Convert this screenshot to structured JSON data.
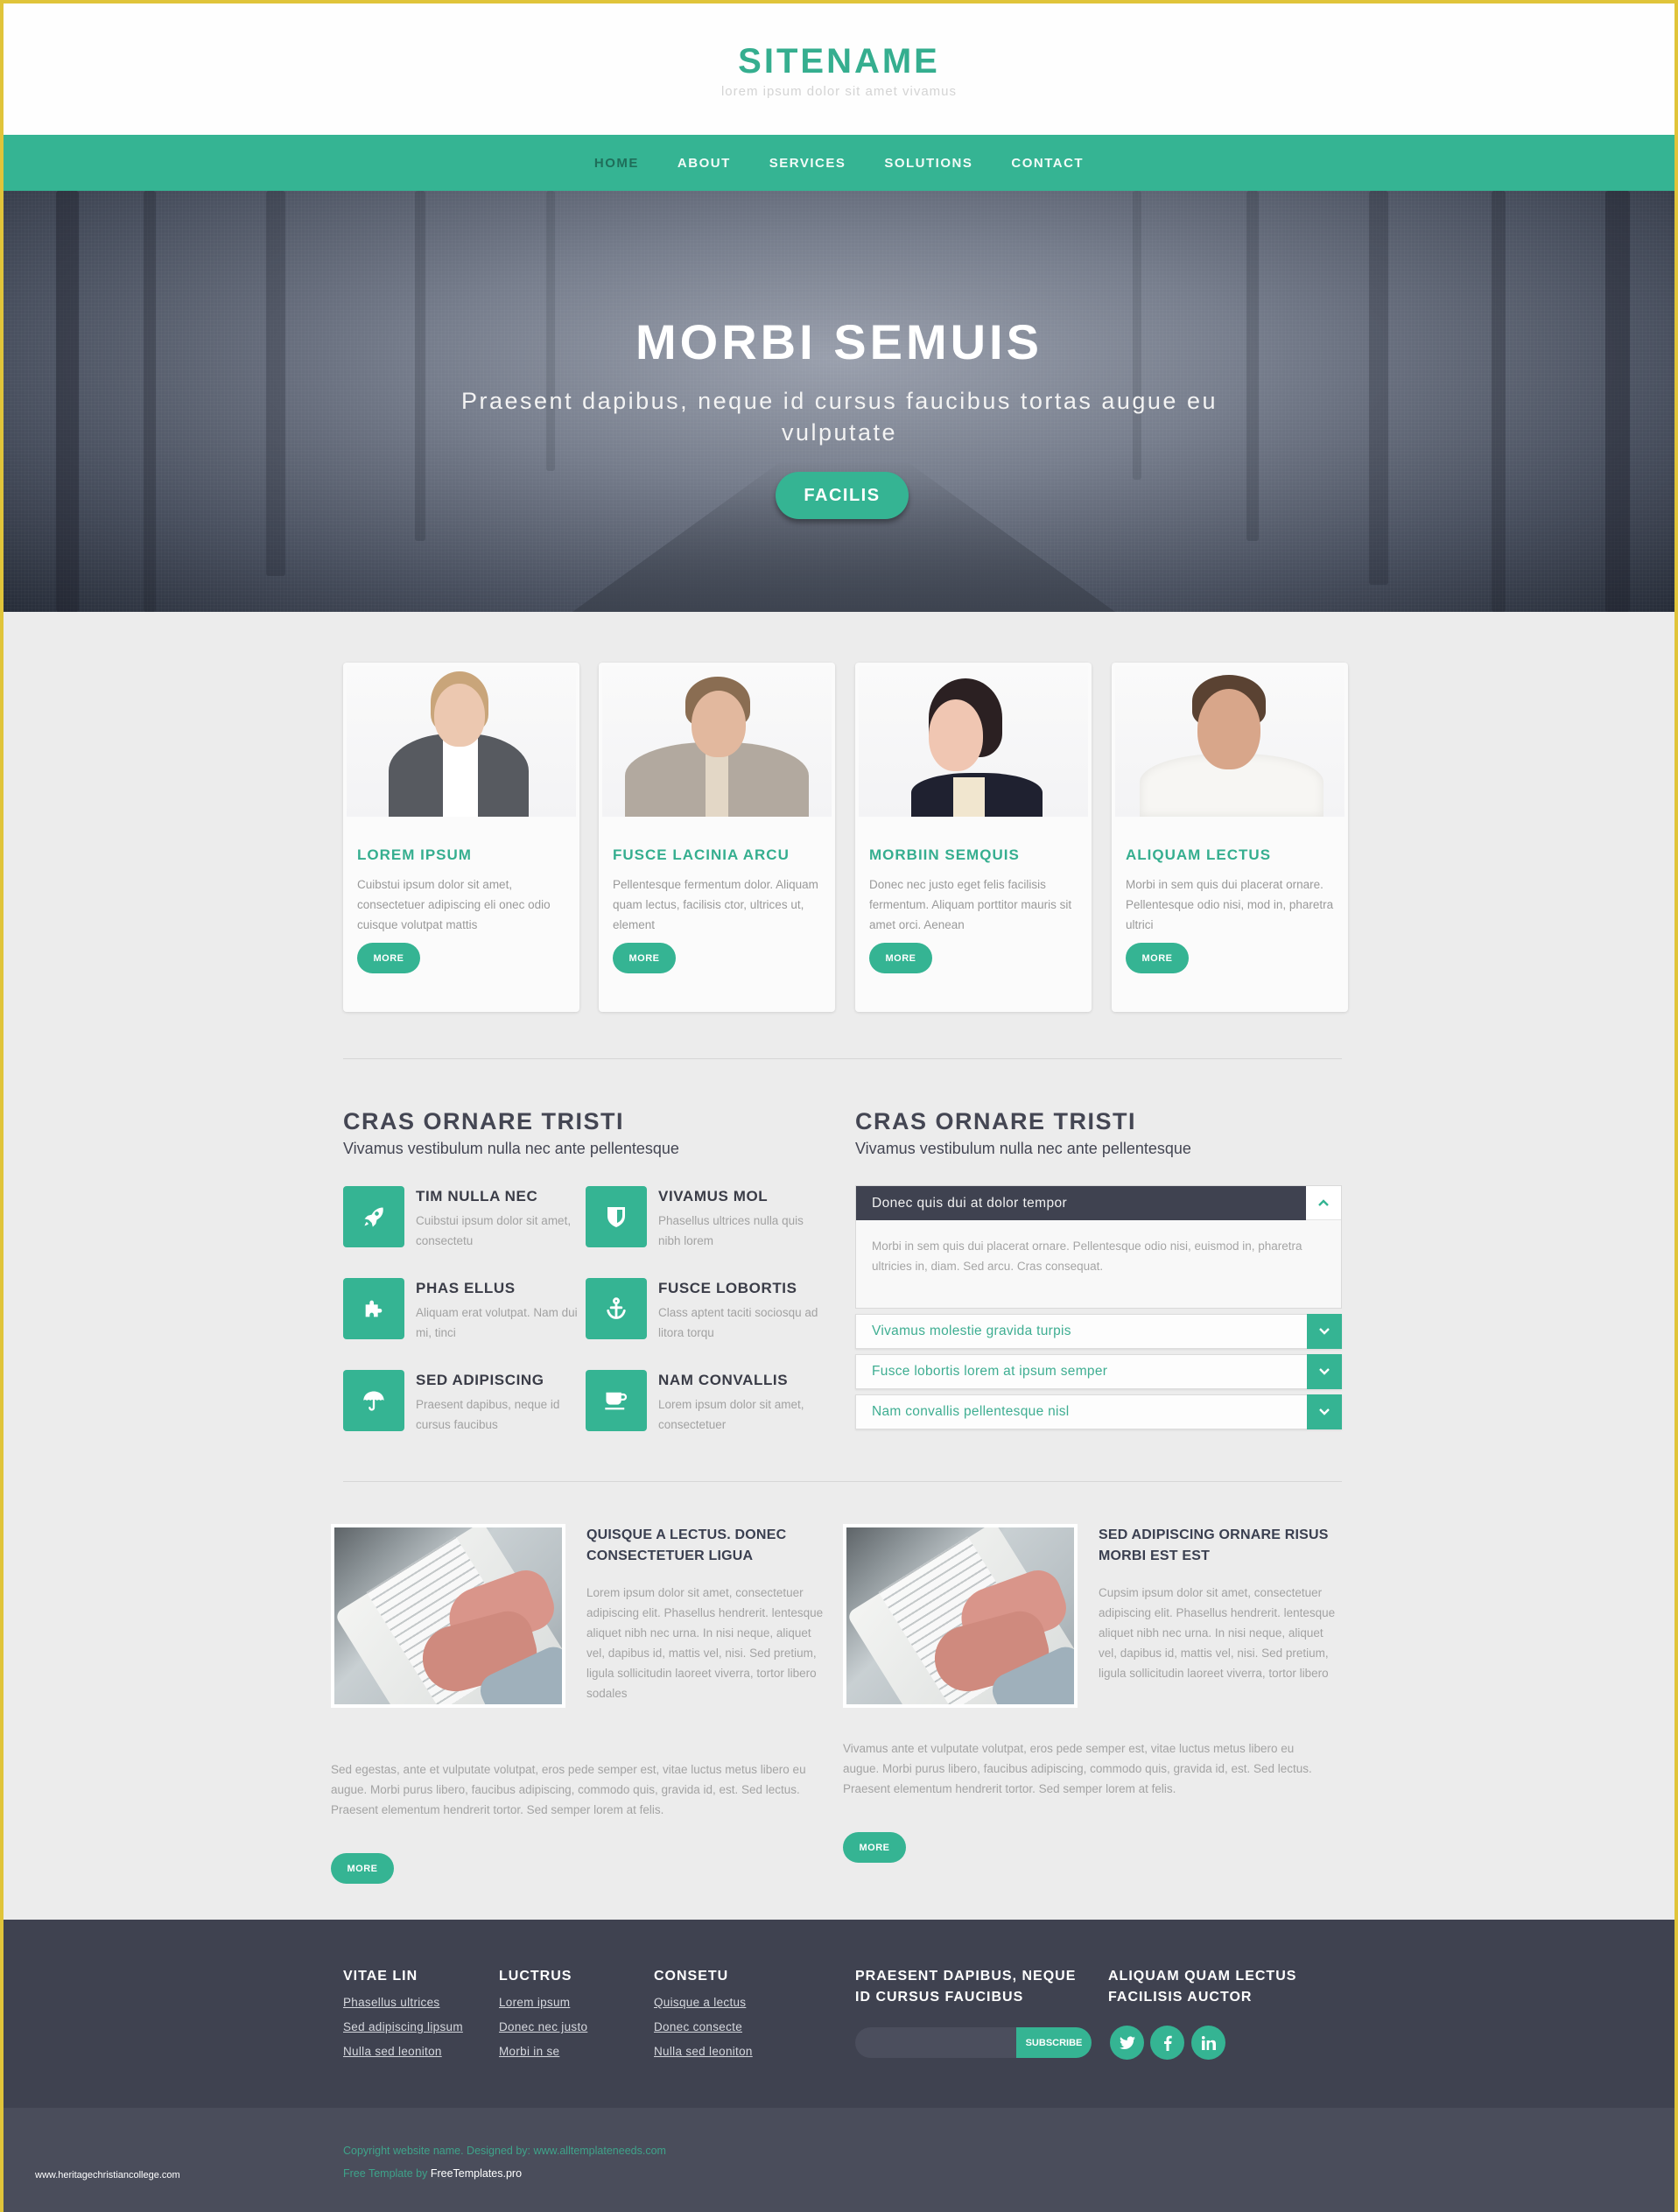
{
  "header": {
    "site_name": "SITENAME",
    "tagline": "lorem ipsum dolor sit amet vivamus"
  },
  "nav": {
    "items": [
      {
        "label": "HOME",
        "active": true
      },
      {
        "label": "ABOUT",
        "active": false
      },
      {
        "label": "SERVICES",
        "active": false
      },
      {
        "label": "SOLUTIONS",
        "active": false
      },
      {
        "label": "CONTACT",
        "active": false
      }
    ]
  },
  "hero": {
    "title": "MORBI SEMUIS",
    "subtitle": "Praesent dapibus, neque id cursus faucibus tortas augue eu vulputate",
    "button_label": "FACILIS"
  },
  "team": [
    {
      "name": "LOREM IPSUM",
      "text": "Cuibstui ipsum dolor sit amet, consectetuer adipiscing eli onec odio cuisque volutpat mattis",
      "button": "MORE"
    },
    {
      "name": "FUSCE LACINIA ARCU",
      "text": "Pellentesque fermentum dolor. Aliquam quam lectus, facilisis ctor, ultrices ut, element",
      "button": "MORE"
    },
    {
      "name": "MORBIIN SEMQUIS",
      "text": "Donec nec justo eget felis facilisis fermentum. Aliquam porttitor mauris sit amet orci. Aenean",
      "button": "MORE"
    },
    {
      "name": "ALIQUAM LECTUS",
      "text": "Morbi in sem quis dui placerat ornare. Pellentesque odio nisi, mod in, pharetra ultrici",
      "button": "MORE"
    }
  ],
  "features": {
    "title": "CRAS ORNARE TRISTI",
    "subtitle": "Vivamus vestibulum nulla nec ante pellentesque",
    "items": [
      {
        "icon": "rocket-icon",
        "title": "TIM NULLA NEC",
        "text": "Cuibstui ipsum dolor sit amet, consectetu"
      },
      {
        "icon": "shield-icon",
        "title": "VIVAMUS MOL",
        "text": "Phasellus ultrices nulla quis nibh lorem"
      },
      {
        "icon": "puzzle-icon",
        "title": "PHAS ELLUS",
        "text": "Aliquam erat volutpat. Nam dui mi, tinci"
      },
      {
        "icon": "anchor-icon",
        "title": "FUSCE LOBORTIS",
        "text": "Class aptent taciti sociosqu ad litora torqu"
      },
      {
        "icon": "umbrella-icon",
        "title": "SED ADIPISCING",
        "text": "Praesent dapibus, neque id cursus faucibus"
      },
      {
        "icon": "coffee-cup-icon",
        "title": "NAM CONVALLIS",
        "text": "Lorem ipsum dolor sit amet, consectetuer"
      }
    ]
  },
  "accordion": {
    "title": "CRAS ORNARE TRISTI",
    "subtitle": "Vivamus vestibulum nulla nec ante pellentesque",
    "open": {
      "label": "Donec quis dui at dolor tempor",
      "body": "Morbi in sem quis dui placerat ornare. Pellentesque odio nisi, euismod in, pharetra ultricies in, diam. Sed arcu. Cras consequat."
    },
    "items": [
      {
        "label": "Vivamus molestie gravida turpis"
      },
      {
        "label": "Fusce lobortis lorem at ipsum semper"
      },
      {
        "label": "Nam convallis pellentesque nisl"
      }
    ]
  },
  "articles": [
    {
      "title": "QUISQUE A LECTUS. DONEC CONSECTETUER LIGUA",
      "body": "Lorem ipsum dolor sit amet, consectetuer adipiscing elit. Phasellus hendrerit. lentesque aliquet nibh nec urna. In nisi neque, aliquet vel, dapibus id, mattis vel, nisi. Sed pretium, ligula sollicitudin laoreet viverra, tortor libero sodales",
      "more_text": "Sed egestas, ante et vulputate volutpat, eros pede semper est, vitae luctus metus libero eu augue. Morbi purus libero, faucibus adipiscing, commodo quis, gravida id, est. Sed lectus. Praesent elementum hendrerit tortor. Sed semper lorem at felis.",
      "button": "MORE"
    },
    {
      "title": "SED ADIPISCING ORNARE RISUS MORBI EST EST",
      "body": "Cupsim ipsum dolor sit amet, consectetuer adipiscing elit. Phasellus hendrerit. lentesque aliquet nibh nec urna. In nisi neque, aliquet vel, dapibus id, mattis vel, nisi. Sed pretium, ligula sollicitudin laoreet viverra, tortor libero",
      "more_text": "Vivamus ante et vulputate volutpat, eros pede semper est, vitae luctus metus libero eu augue. Morbi purus libero, faucibus adipiscing, commodo quis, gravida id, est. Sed lectus. Praesent elementum hendrerit tortor. Sed semper lorem at felis.",
      "button": "MORE"
    }
  ],
  "footer": {
    "columns": [
      {
        "title": "VITAE LIN",
        "links": [
          "Phasellus ultrices",
          "Sed adipiscing lipsum",
          "Nulla sed leoniton"
        ]
      },
      {
        "title": "LUCTRUS",
        "links": [
          "Lorem ipsum",
          "Donec nec justo",
          "Morbi in se"
        ]
      },
      {
        "title": "CONSETU",
        "links": [
          "Quisque a lectus",
          "Donec consecte",
          "Nulla sed leoniton"
        ]
      }
    ],
    "newsletter": {
      "title": "PRAESENT DAPIBUS, NEQUE ID CURSUS FAUCIBUS",
      "input_value": "",
      "button": "SUBSCRIBE"
    },
    "social": {
      "title": "ALIQUAM QUAM LECTUS FACILISIS AUCTOR",
      "icons": [
        "twitter-icon",
        "facebook-icon",
        "linkedin-icon"
      ]
    }
  },
  "bottom": {
    "copyright": "Copyright website name. Designed by: www.alltemplateneeds.com",
    "free_prefix": "Free Template by ",
    "free_link": "FreeTemplates.pro",
    "watermark": "www.heritagechristiancollege.com"
  },
  "colors": {
    "accent": "#35b493",
    "dark": "#3f4250",
    "page_bg": "#ececec",
    "frame": "#e0c43a"
  }
}
